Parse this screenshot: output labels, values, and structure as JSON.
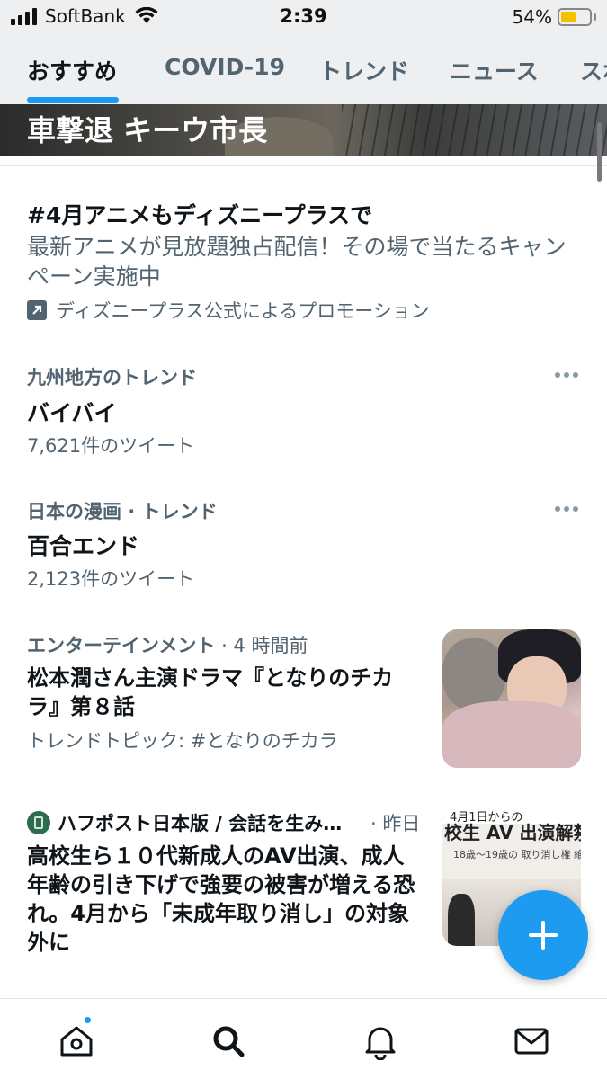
{
  "status_bar": {
    "carrier": "SoftBank",
    "time": "2:39",
    "battery": "54%",
    "battery_level": 0.54,
    "icons": [
      "signal-icon",
      "wifi-icon",
      "battery-icon"
    ]
  },
  "tabs": [
    {
      "label": "おすすめ",
      "active": true
    },
    {
      "label": "COVID-19",
      "active": false
    },
    {
      "label": "トレンド",
      "active": false
    },
    {
      "label": "ニュース",
      "active": false
    },
    {
      "label": "スポーツ",
      "active": false
    }
  ],
  "hero": {
    "title": "車撃退 キーウ市長"
  },
  "promoted": {
    "title": "#4月アニメもディズニープラスで",
    "description": "最新アニメが見放題独占配信！その場で当たるキャンペーン実施中",
    "promoted_by": "ディズニープラス公式によるプロモーション",
    "icon": "promoted-arrow-icon"
  },
  "trends": [
    {
      "context": "九州地方のトレンド",
      "name": "バイバイ",
      "count": "7,621件のツイート"
    },
    {
      "context": "日本の漫画 · トレンド",
      "name": "百合エンド",
      "count": "2,123件のツイート"
    }
  ],
  "stories": [
    {
      "category": "エンターテインメント",
      "time": "· 4 時間前",
      "headline": "松本潤さん主演ドラマ『となりのチカラ』第８話",
      "topic": "トレンドトピック: #となりのチカラ"
    },
    {
      "source": "ハフポスト日本版 / 会話を生み…",
      "time": "· 昨日",
      "headline": "高校生ら１０代新成人のAV出演、成人年齢の引き下げで強要の被害が増える恐れ。4月から「未成年取り消し」の対象外に",
      "thumb_bar": "4月1日からの",
      "thumb_text": "校生 AV 出演解禁を",
      "thumb_sub": "18歳〜19歳の 取り消し権 維"
    }
  ],
  "fab": {
    "icon": "plus-icon"
  },
  "bottom_nav": [
    {
      "name": "home-icon",
      "has_badge": true
    },
    {
      "name": "search-icon",
      "has_badge": false
    },
    {
      "name": "bell-icon",
      "has_badge": false
    },
    {
      "name": "mail-icon",
      "has_badge": false
    }
  ],
  "colors": {
    "accent": "#1d9bf0",
    "text_primary": "#0f1419",
    "text_secondary": "#536471",
    "tab_bar_bg": "#eeeff1"
  }
}
